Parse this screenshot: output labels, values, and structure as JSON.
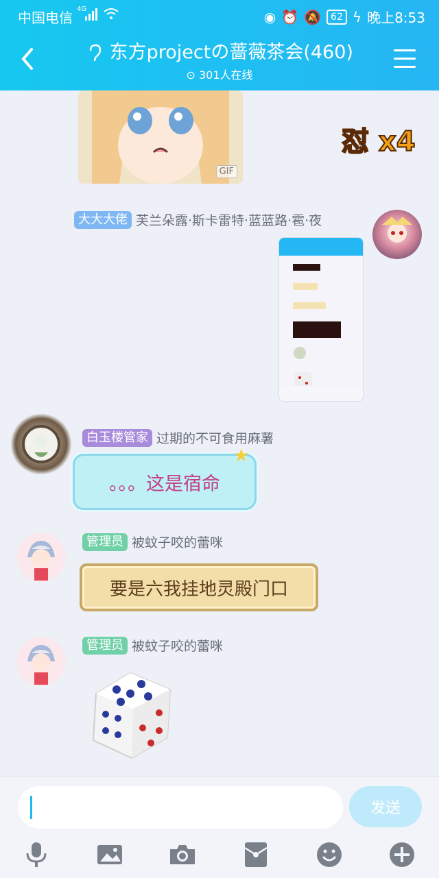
{
  "status": {
    "carrier": "中国电信",
    "network": "4G",
    "battery": "62",
    "time": "晚上8:53"
  },
  "header": {
    "title": "东方projectの蔷薇茶会(460)",
    "online": "301人在线"
  },
  "messages": [
    {
      "type": "gif",
      "tag": "GIF",
      "sticker": "怼 x4"
    },
    {
      "badge": "大大大佬",
      "name": "芙兰朵露·斯卡雷特·蓝蓝路·雹·夜",
      "badge_color": "#7fb7f3"
    },
    {
      "badge": "白玉楼管家",
      "name": "过期的不可食用麻薯",
      "text": "。。。这是宿命",
      "badge_color": "#a98bdc"
    },
    {
      "badge": "管理员",
      "name": "被蚊子咬的蕾咪",
      "text": "要是六我挂地灵殿门口",
      "badge_color": "#70d0a7"
    },
    {
      "badge": "管理员",
      "name": "被蚊子咬的蕾咪",
      "type": "dice",
      "badge_color": "#70d0a7"
    }
  ],
  "composer": {
    "send_label": "发送"
  },
  "icons": [
    "mic-icon",
    "image-icon",
    "camera-icon",
    "redpacket-icon",
    "emoji-icon",
    "plus-icon"
  ]
}
